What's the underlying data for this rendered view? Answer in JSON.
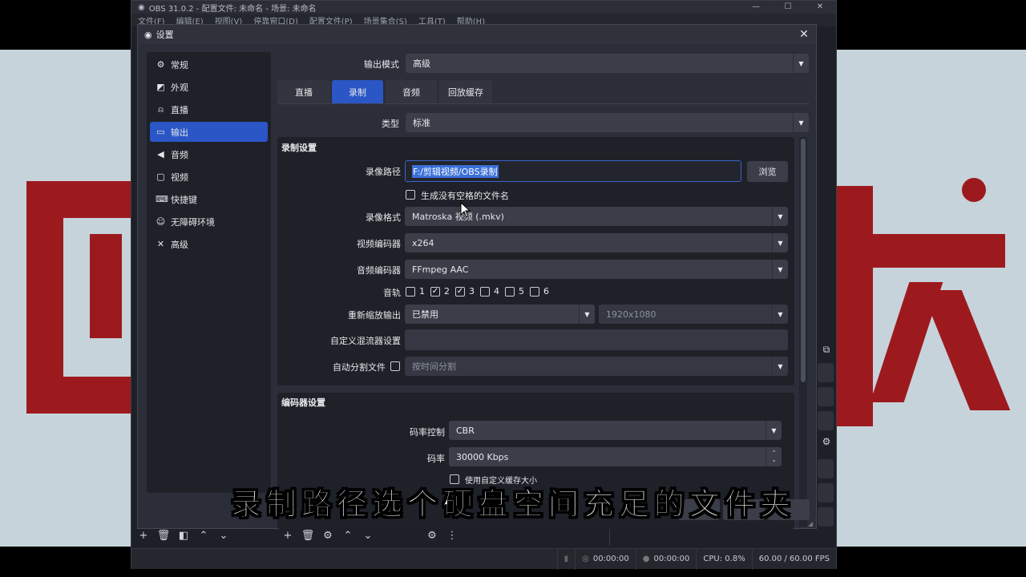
{
  "app": {
    "title": "OBS 31.0.2 - 配置文件: 未命名 - 场景: 未命名",
    "menu": [
      "文件(F)",
      "编辑(E)",
      "视图(V)",
      "停靠窗口(D)",
      "配置文件(P)",
      "场景集合(S)",
      "工具(T)",
      "帮助(H)"
    ],
    "window_controls": [
      "—",
      "☐",
      "✕"
    ]
  },
  "status": {
    "rec_time": "00:00:00",
    "stream_time": "00:00:00",
    "cpu": "CPU: 0.8%",
    "fps": "60.00 / 60.00 FPS"
  },
  "settings": {
    "title": "设置",
    "close": "✕",
    "sidebar": [
      {
        "label": "常规",
        "icon": "gear-icon",
        "glyph": "⚙"
      },
      {
        "label": "外观",
        "icon": "brush-icon",
        "glyph": "◩"
      },
      {
        "label": "直播",
        "icon": "antenna-icon",
        "glyph": "⍝"
      },
      {
        "label": "输出",
        "icon": "output-icon",
        "glyph": "▭"
      },
      {
        "label": "音频",
        "icon": "speaker-icon",
        "glyph": "◀"
      },
      {
        "label": "视频",
        "icon": "monitor-icon",
        "glyph": "▢"
      },
      {
        "label": "快捷键",
        "icon": "keyboard-icon",
        "glyph": "⌨"
      },
      {
        "label": "无障碍环境",
        "icon": "accessibility-icon",
        "glyph": "☺"
      },
      {
        "label": "高级",
        "icon": "tools-icon",
        "glyph": "✕"
      }
    ],
    "output_mode_label": "输出模式",
    "output_mode": "高级",
    "tabs": [
      "直播",
      "录制",
      "音频",
      "回放缓存"
    ],
    "type_label": "类型",
    "type_value": "标准",
    "recording": {
      "group_title": "录制设置",
      "path_label": "录像路径",
      "path_value": "F:/剪辑视频/OBS录制",
      "browse": "浏览",
      "no_space_label": "生成没有空格的文件名",
      "format_label": "录像格式",
      "format_value": "Matroska 视频 (.mkv)",
      "video_encoder_label": "视频编码器",
      "video_encoder": "x264",
      "audio_encoder_label": "音频编码器",
      "audio_encoder": "FFmpeg AAC",
      "tracks_label": "音轨",
      "tracks": [
        {
          "n": "1",
          "checked": false
        },
        {
          "n": "2",
          "checked": true
        },
        {
          "n": "3",
          "checked": true
        },
        {
          "n": "4",
          "checked": false
        },
        {
          "n": "5",
          "checked": false
        },
        {
          "n": "6",
          "checked": false
        }
      ],
      "rescale_label": "重新缩放输出",
      "rescale_value": "已禁用",
      "rescale_res": "1920x1080",
      "muxer_label": "自定义混流器设置",
      "muxer_value": "",
      "split_label": "自动分割文件",
      "split_value": "按时间分割"
    },
    "encoder": {
      "group_title": "编码器设置",
      "rate_control_label": "码率控制",
      "rate_control": "CBR",
      "bitrate_label": "码率",
      "bitrate": "30000 Kbps",
      "buffer_label": "使用自定义缓存大小"
    }
  },
  "subtitle": "录制路径选个硬盘空间充足的文件夹"
}
